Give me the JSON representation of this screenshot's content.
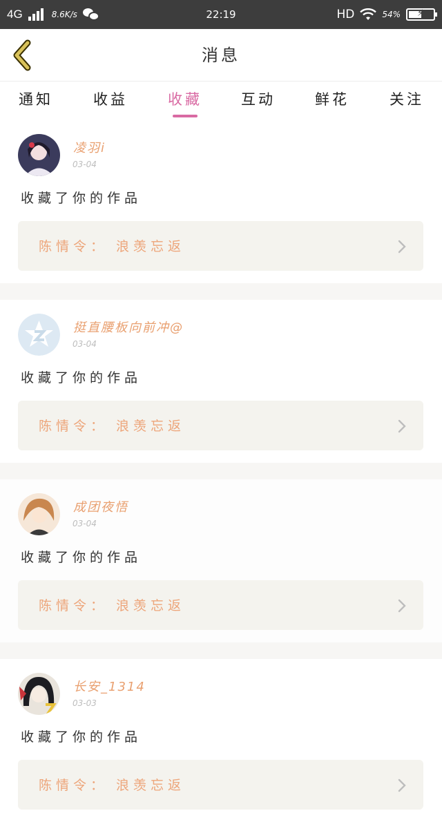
{
  "status_bar": {
    "network": "4G",
    "speed": "8.6K/s",
    "time": "22:19",
    "hd": "HD",
    "battery": "54%",
    "battery_level": 0.54
  },
  "header": {
    "title": "消息",
    "back_icon": "back-chevron-icon"
  },
  "tabs": [
    {
      "label": "通知",
      "active": false
    },
    {
      "label": "收益",
      "active": false
    },
    {
      "label": "收藏",
      "active": true
    },
    {
      "label": "互动",
      "active": false
    },
    {
      "label": "鲜花",
      "active": false
    },
    {
      "label": "关注",
      "active": false
    }
  ],
  "accent_color": "#d96aa3",
  "messages": [
    {
      "username": "凌羽i",
      "date": "03-04",
      "action": "收藏了你的作品",
      "work": "陈情令：  浪羡忘返"
    },
    {
      "username": "挺直腰板向前冲@",
      "date": "03-04",
      "action": "收藏了你的作品",
      "work": "陈情令：  浪羡忘返"
    },
    {
      "username": "成团夜悟",
      "date": "03-04",
      "action": "收藏了你的作品",
      "work": "陈情令：  浪羡忘返"
    },
    {
      "username": "长安_1314",
      "date": "03-03",
      "action": "收藏了你的作品",
      "work": "陈情令：  浪羡忘返"
    }
  ]
}
